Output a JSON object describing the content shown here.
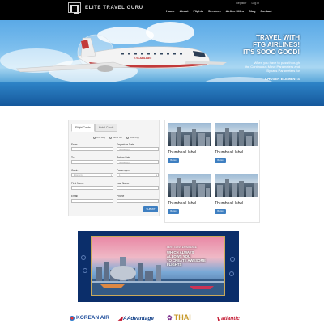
{
  "header": {
    "brand": "ELITE TRAVEL GURU",
    "top_links": [
      "Register",
      "Log in"
    ],
    "nav": [
      "Home",
      "About",
      "Flights",
      "Services",
      "Airline Miles",
      "Blog",
      "Contact"
    ]
  },
  "hero": {
    "headline_lines": [
      "TRAVEL WITH",
      "FTG AIRLINES!",
      "IT'S SOOO GOOD!"
    ],
    "sub_lines": [
      "When you have to pass through",
      "the Continuous Move Parameters and",
      "Bypass Parameters for"
    ],
    "cta": "CHOSEN ELEMENTS",
    "plane_livery": "ETG AIRLINES"
  },
  "search": {
    "tabs": [
      "Flight Cards",
      "Hotel Cards"
    ],
    "trip_types": [
      "One way",
      "round trip",
      "multi-city"
    ],
    "fields": [
      {
        "label": "From",
        "value": ""
      },
      {
        "label": "Departure Date",
        "value": "mm/dd/yyyy"
      },
      {
        "label": "To",
        "value": ""
      },
      {
        "label": "Return Date",
        "value": "mm/dd/yyyy"
      },
      {
        "label": "Cabin",
        "value": "Economy"
      },
      {
        "label": "Passengers",
        "value": "1"
      },
      {
        "label": "First Name",
        "value": ""
      },
      {
        "label": "Last Name",
        "value": ""
      },
      {
        "label": "Email",
        "value": ""
      },
      {
        "label": "Phone",
        "value": ""
      }
    ],
    "submit": "SUBMIT"
  },
  "thumbnails": [
    {
      "label": "Thumbnail label",
      "button": "Button"
    },
    {
      "label": "Thumbnail label",
      "button": "Button"
    },
    {
      "label": "Thumbnail label",
      "button": "Button"
    },
    {
      "label": "Thumbnail label",
      "button": "Button"
    }
  ],
  "ad": {
    "small": "FIRST CLASS EXPERIENCE",
    "lines": [
      "WHICH ALWAYS",
      "ALLOWS YOU",
      "TO CREATE AWESOME",
      "FLIGHTS"
    ]
  },
  "partners": [
    {
      "name": "KOREAN AIR",
      "color": "#1f4e9c"
    },
    {
      "name": "AAdvantage",
      "color": "#0a3a85"
    },
    {
      "name": "THAI",
      "color": "#c79a2b"
    },
    {
      "name": "atlantic",
      "color": "#c3162f"
    }
  ]
}
